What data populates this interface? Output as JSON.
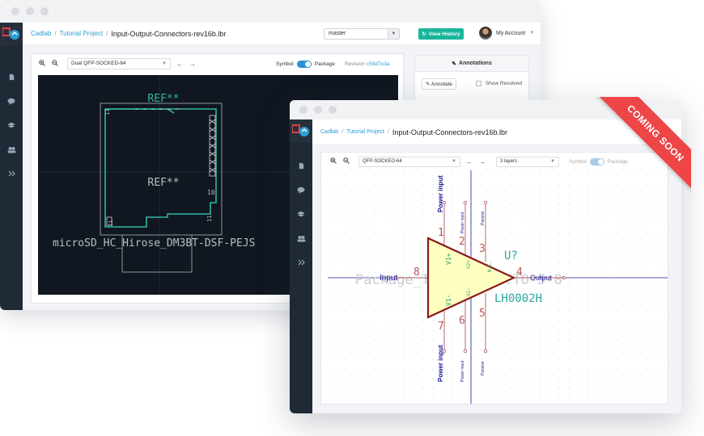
{
  "colors": {
    "sidebar": "#1f2a36",
    "accent": "#2a9fd6",
    "history_button": "#18b59b",
    "ribbon": "#ee4546",
    "pcb_background": "#101720",
    "pcb_outline": "#9aa0a6",
    "pcb_teal": "#2fb5a5",
    "schematic_body": "#ffffc2",
    "schematic_outline": "#8b1a1a",
    "schematic_pin": "#b55a5a",
    "schematic_label": "#1a1a9a"
  },
  "window_back": {
    "breadcrumb": {
      "root": "Cadlab",
      "project": "Tutorial Project",
      "file": "Input-Output-Connectors-rev16b.lbr"
    },
    "branch": "master",
    "view_history": "View History",
    "account": "My Account",
    "toolbar": {
      "footprint": "Dual QFP-SOCKED-64",
      "symbol": "Symbol",
      "package": "Package",
      "revision_label": "Revision",
      "revision": "c59d7e3a"
    },
    "annotations": {
      "title": "Annotations",
      "annotate": "Annotate",
      "show_resolved": "Show Resolved"
    },
    "pcb": {
      "ref_top": "REF**",
      "ref_center": "REF**",
      "pin_10": "10",
      "pin_11": "11",
      "footprint_name": "microSD_HC_Hirose_DM3BT-DSF-PEJS"
    }
  },
  "window_front": {
    "breadcrumb": {
      "root": "Cadlab",
      "project": "Tutorial Project",
      "file": "Input-Output-Connectors-rev16b.lbr"
    },
    "toolbar": {
      "footprint": "QFP-SOCKEO-64",
      "layers": "3 layers",
      "symbol": "Symbol",
      "package": "Package"
    },
    "schematic": {
      "ref": "U?",
      "value": "LH0002H",
      "package_text": "Package_TO_SOT_THT:TO-5-8",
      "input": "Input",
      "output": "Output",
      "power_input": "Power input",
      "passive": "Passive",
      "pin_1": "1",
      "pin_2": "2",
      "pin_3": "3",
      "pin_4": "4",
      "pin_5": "5",
      "pin_6": "6",
      "pin_7": "7",
      "pin_8": "8",
      "v1p": "V1+",
      "v2p": "V2+",
      "v1m": "V1-",
      "v2m": "V2-",
      "nc": "N.C."
    }
  },
  "ribbon": "COMING SOON"
}
